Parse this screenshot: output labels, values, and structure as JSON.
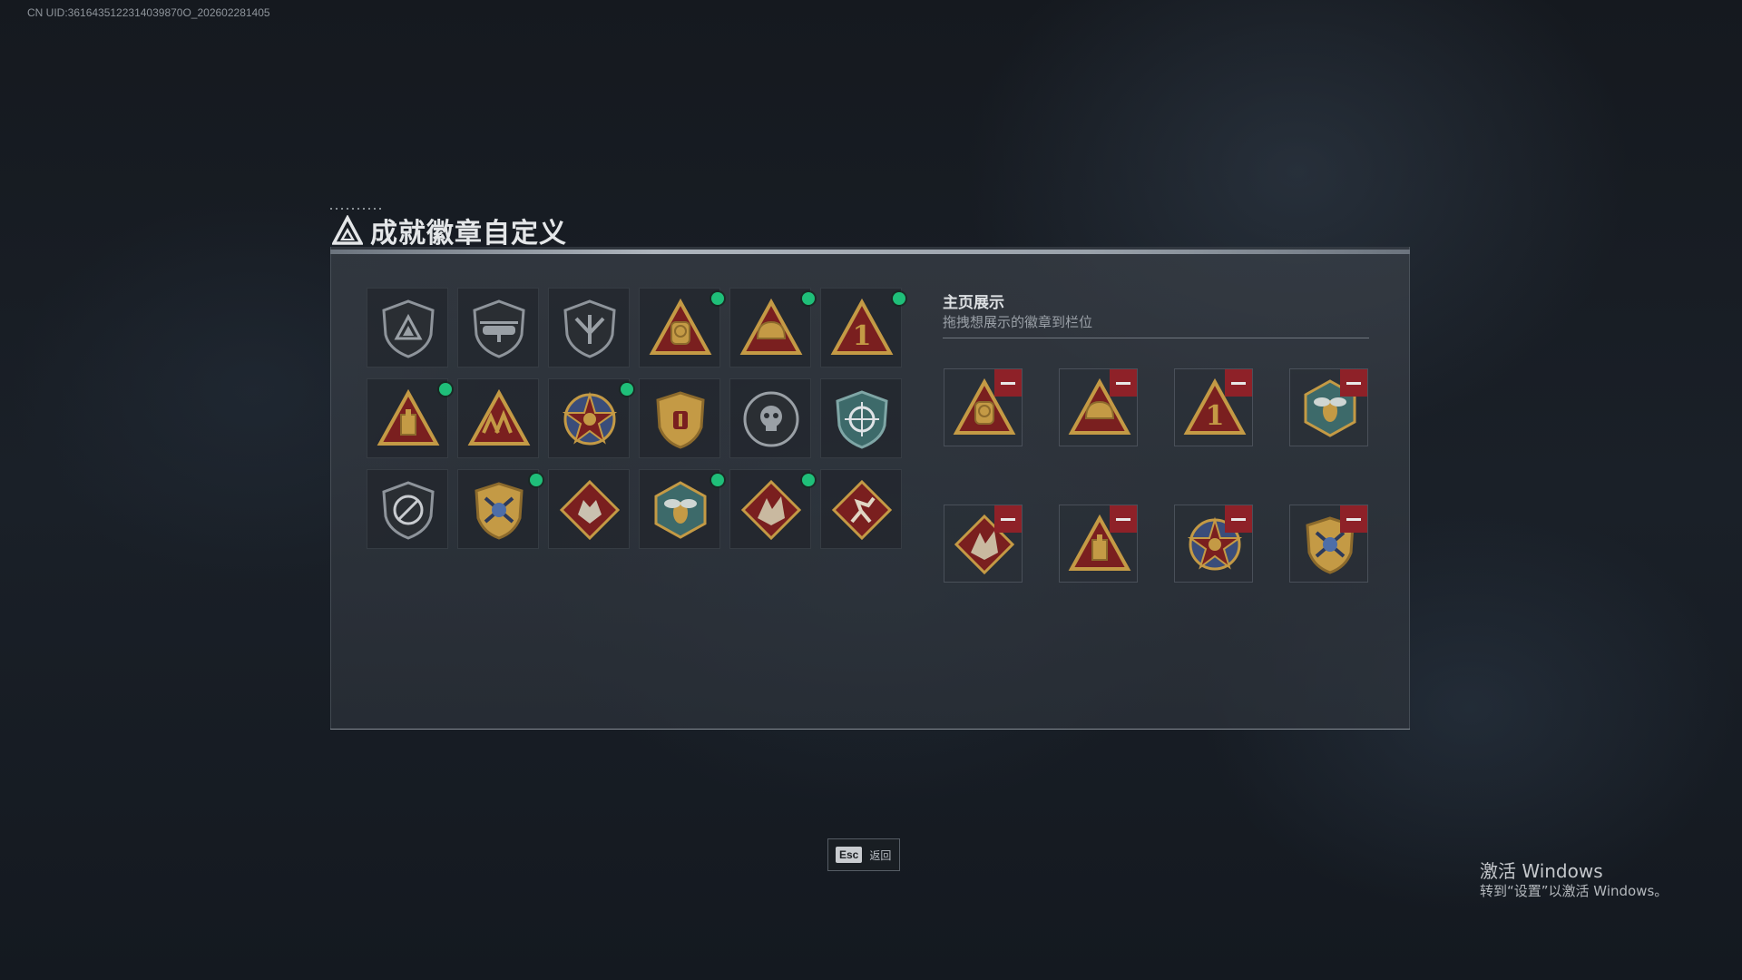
{
  "uid_text": "CN UID:3616435122314039870O_202602281405",
  "title": "成就徽章自定义",
  "badges": [
    {
      "icon": "shield-triangle-badge-icon",
      "new": false
    },
    {
      "icon": "helicopter-shield-badge-icon",
      "new": false
    },
    {
      "icon": "winged-shield-badge-icon",
      "new": false
    },
    {
      "icon": "supply-bag-triangle-badge-icon",
      "new": true
    },
    {
      "icon": "helmet-triangle-badge-icon",
      "new": true
    },
    {
      "icon": "number-one-triangle-badge-icon",
      "new": true
    },
    {
      "icon": "tank-triangle-badge-icon",
      "new": true
    },
    {
      "icon": "soldiers-triangle-badge-icon",
      "new": false
    },
    {
      "icon": "star-medal-badge-icon",
      "new": true
    },
    {
      "icon": "crest-badge-icon",
      "new": false
    },
    {
      "icon": "skull-round-badge-icon",
      "new": false
    },
    {
      "icon": "crosshair-shield-badge-icon",
      "new": false
    },
    {
      "icon": "no-gun-shield-badge-icon",
      "new": false
    },
    {
      "icon": "crossed-rifles-crest-badge-icon",
      "new": true
    },
    {
      "icon": "wolf-diamond-badge-icon",
      "new": false
    },
    {
      "icon": "wasp-hex-badge-icon",
      "new": true
    },
    {
      "icon": "dragon-diamond-badge-icon",
      "new": true
    },
    {
      "icon": "runner-diamond-badge-icon",
      "new": false
    }
  ],
  "showcase": {
    "title": "主页展示",
    "subtitle": "拖拽想展示的徽章到栏位",
    "slots": [
      {
        "icon": "supply-bag-triangle-badge-icon"
      },
      {
        "icon": "helmet-triangle-badge-icon"
      },
      {
        "icon": "number-one-triangle-badge-icon"
      },
      {
        "icon": "wasp-hex-badge-icon"
      },
      {
        "icon": "dragon-diamond-badge-icon"
      },
      {
        "icon": "tank-triangle-badge-icon"
      },
      {
        "icon": "star-medal-badge-icon"
      },
      {
        "icon": "crossed-rifles-crest-badge-icon"
      }
    ]
  },
  "footer": {
    "esc_key": "Esc",
    "esc_label": "返回"
  },
  "watermark": {
    "line1": "激活 Windows",
    "line2": "转到“设置”以激活 Windows。"
  },
  "colors": {
    "new_dot": "#1fbf79",
    "remove_button": "#8e2128",
    "panel_accent": "#aeb5bd",
    "badge_gold": "#c49a45",
    "badge_red": "#7a1f1f"
  }
}
